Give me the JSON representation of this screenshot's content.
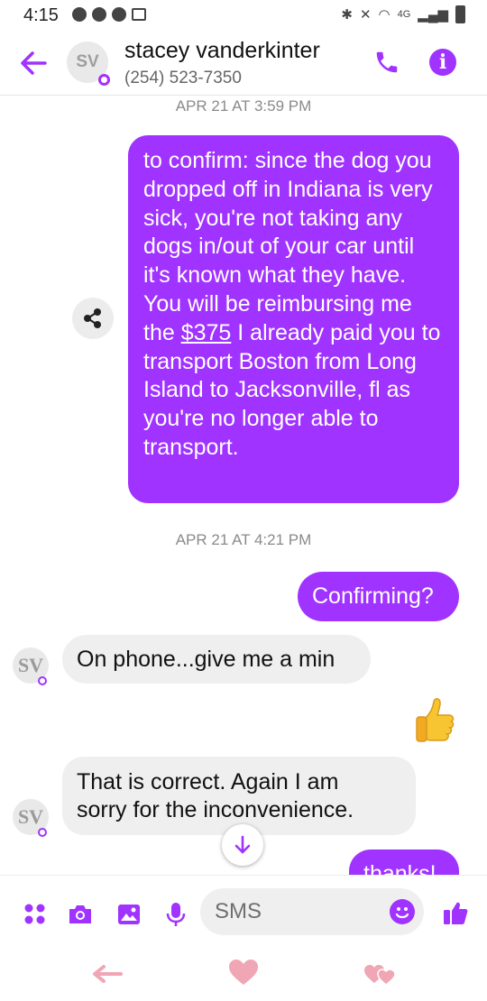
{
  "status_bar": {
    "time": "4:15",
    "network_label": "4G"
  },
  "header": {
    "avatar_initials": "SV",
    "contact_name": "stacey vanderkinter",
    "contact_phone": "(254) 523-7350"
  },
  "conversation": {
    "timestamp_1": "APR 21 AT 3:59 PM",
    "message_1": {
      "before_link": "to confirm: since the dog you dropped off in Indiana is very sick, you're not taking any dogs in/out of your car until it's known what they have. You will be reimbursing me the ",
      "link": "$375",
      "after_link": " I already paid you to transport Boston from Long Island to Jacksonville, fl as you're no longer able to transport."
    },
    "timestamp_2": "APR 21 AT 4:21 PM",
    "message_2": "Confirming?",
    "message_3": "On phone...give me a min",
    "avatar_initials": "SV",
    "message_5_line1": "That is correct.  Again I am",
    "message_5_line2": "sorry for the inconvenience.",
    "message_6": "thanks!"
  },
  "composer": {
    "placeholder": "SMS"
  },
  "colors": {
    "accent": "#a033ff",
    "incoming_bubble": "#efefef",
    "nav_pink": "#f0a6b4"
  }
}
